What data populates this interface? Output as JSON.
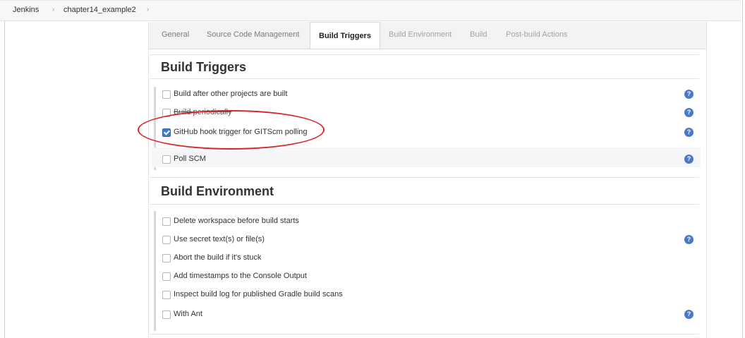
{
  "breadcrumb": {
    "items": [
      "Jenkins",
      "chapter14_example2"
    ],
    "separator": "›"
  },
  "tabs": [
    {
      "label": "General",
      "state": "normal"
    },
    {
      "label": "Source Code Management",
      "state": "normal"
    },
    {
      "label": "Build Triggers",
      "state": "active"
    },
    {
      "label": "Build Environment",
      "state": "muted"
    },
    {
      "label": "Build",
      "state": "muted"
    },
    {
      "label": "Post-build Actions",
      "state": "muted"
    }
  ],
  "build_triggers": {
    "title": "Build Triggers",
    "options": [
      {
        "label": "Build after other projects are built",
        "checked": false,
        "help": true
      },
      {
        "label": "Build periodically",
        "checked": false,
        "help": true
      },
      {
        "label": "GitHub hook trigger for GITScm polling",
        "checked": true,
        "help": true
      },
      {
        "label": "Poll SCM",
        "checked": false,
        "help": true
      }
    ]
  },
  "build_environment": {
    "title": "Build Environment",
    "options": [
      {
        "label": "Delete workspace before build starts",
        "checked": false,
        "help": false
      },
      {
        "label": "Use secret text(s) or file(s)",
        "checked": false,
        "help": true
      },
      {
        "label": "Abort the build if it's stuck",
        "checked": false,
        "help": false
      },
      {
        "label": "Add timestamps to the Console Output",
        "checked": false,
        "help": false
      },
      {
        "label": "Inspect build log for published Gradle build scans",
        "checked": false,
        "help": false
      },
      {
        "label": "With Ant",
        "checked": false,
        "help": true
      }
    ]
  },
  "help_glyph": "?",
  "colors": {
    "annotation": "#d6282a",
    "help": "#4b79c6",
    "checkbox_checked": "#3f7ad8"
  }
}
